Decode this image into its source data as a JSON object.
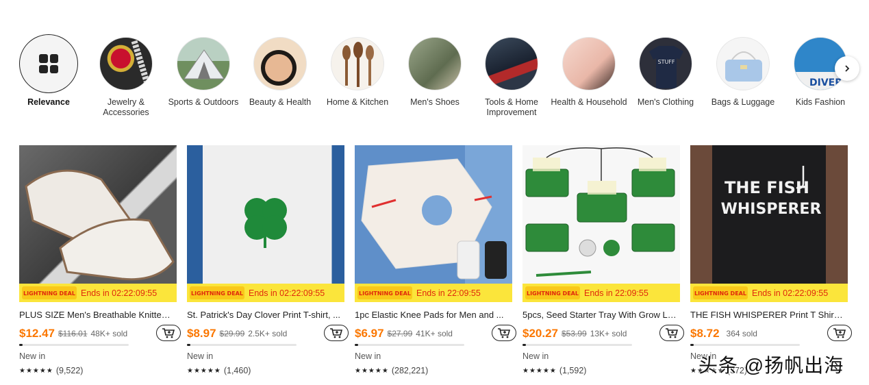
{
  "categories": [
    {
      "label": "Relevance",
      "icon": "grid-icon",
      "selected": true
    },
    {
      "label": "Jewelry & Accessories",
      "icon": "watch-image"
    },
    {
      "label": "Sports & Outdoors",
      "icon": "tent-image"
    },
    {
      "label": "Beauty & Health",
      "icon": "compact-powder-image"
    },
    {
      "label": "Home & Kitchen",
      "icon": "wooden-spoons-image"
    },
    {
      "label": "Men's Shoes",
      "icon": "shoes-image"
    },
    {
      "label": "Tools & Home Improvement",
      "icon": "power-tool-image"
    },
    {
      "label": "Health & Household",
      "icon": "massager-image"
    },
    {
      "label": "Men's Clothing",
      "icon": "tshirt-image"
    },
    {
      "label": "Bags & Luggage",
      "icon": "handbag-image"
    },
    {
      "label": "Kids Fashion",
      "icon": "kids-shirt-image"
    }
  ],
  "deal_badge_text": "LIGHTNING DEAL",
  "products": [
    {
      "title": "PLUS SIZE Men's Breathable Knitted ...",
      "price": "$12.47",
      "original_price": "$116.01",
      "sold": "48K+ sold",
      "deal_ends": "Ends in 02:22:09:55",
      "progress": 0.03,
      "new_label": "New in",
      "stars": "★★★★★",
      "reviews": "(9,522)",
      "image": "white-knit-sneakers"
    },
    {
      "title": "St. Patrick's Day Clover Print T-shirt, ...",
      "price": "$8.97",
      "original_price": "$29.99",
      "sold": "2.5K+ sold",
      "deal_ends": "Ends in 02:22:09:55",
      "progress": 0.03,
      "new_label": "New in",
      "stars": "★★★★★",
      "reviews": "(1,460)",
      "image": "clover-sweatshirt"
    },
    {
      "title": "1pc Elastic Knee Pads for Men and ...",
      "price": "$6.97",
      "original_price": "$27.99",
      "sold": "41K+ sold",
      "deal_ends": "Ends in 22:09:55",
      "progress": 0.03,
      "new_label": "New in",
      "stars": "★★★★★",
      "reviews": "(282,221)",
      "image": "knee-pad"
    },
    {
      "title": "5pcs, Seed Starter Tray With Grow Li...",
      "price": "$20.27",
      "original_price": "$53.99",
      "sold": "13K+ sold",
      "deal_ends": "Ends in 22:09:55",
      "progress": 0.03,
      "new_label": "New in",
      "stars": "★★★★★",
      "reviews": "(1,592)",
      "image": "seed-trays"
    },
    {
      "title": "THE FISH WHISPERER Print T Shirt, T...",
      "price": "$8.72",
      "original_price": "",
      "sold": "364 sold",
      "deal_ends": "Ends in 02:22:09:55",
      "progress": 0.03,
      "new_label": "New in",
      "stars": "★★★★★",
      "reviews": "(372)",
      "image": "fish-whisperer-tshirt",
      "shirt_text_1": "THE FISH",
      "shirt_text_2": "WHISPERER"
    }
  ],
  "watermark": "头条 @扬帆出海",
  "colors": {
    "price": "#fb7701",
    "deal_bar": "#fbe53b",
    "deal_text": "#e0280c"
  }
}
